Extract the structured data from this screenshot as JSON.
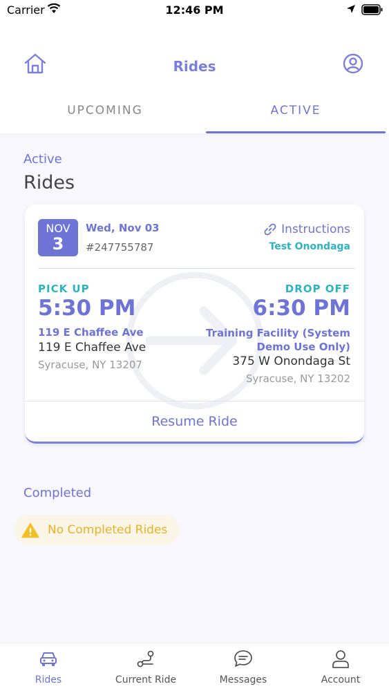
{
  "status_bar": {
    "carrier": "Carrier",
    "time": "12:46 PM"
  },
  "header": {
    "title": "Rides"
  },
  "tabs": [
    {
      "label": "UPCOMING"
    },
    {
      "label": "ACTIVE"
    }
  ],
  "section": {
    "subtitle": "Active",
    "title": "Rides"
  },
  "ride": {
    "month": "NOV",
    "day": "3",
    "date": "Wed, Nov 03",
    "id": "#247755787",
    "instructions_label": "Instructions",
    "organization": "Test Onondaga",
    "pickup": {
      "label": "PICK UP",
      "time": "5:30 PM",
      "name": "119 E Chaffee Ave",
      "street": "119 E Chaffee Ave",
      "city": "Syracuse, NY 13207"
    },
    "dropoff": {
      "label": "DROP OFF",
      "time": "6:30 PM",
      "name": "Training Facility (System Demo Use Only)",
      "street": "375 W Onondaga St",
      "city": "Syracuse, NY 13202"
    },
    "resume_label": "Resume Ride"
  },
  "completed": {
    "label": "Completed",
    "empty_message": "No Completed Rides"
  },
  "tab_bar": [
    {
      "label": "Rides",
      "icon": "car-icon"
    },
    {
      "label": "Current Ride",
      "icon": "route-icon"
    },
    {
      "label": "Messages",
      "icon": "chat-icon"
    },
    {
      "label": "Account",
      "icon": "user-icon"
    }
  ],
  "colors": {
    "accent": "#6e73d6",
    "teal": "#2bb5c2",
    "warning": "#e6b325"
  }
}
